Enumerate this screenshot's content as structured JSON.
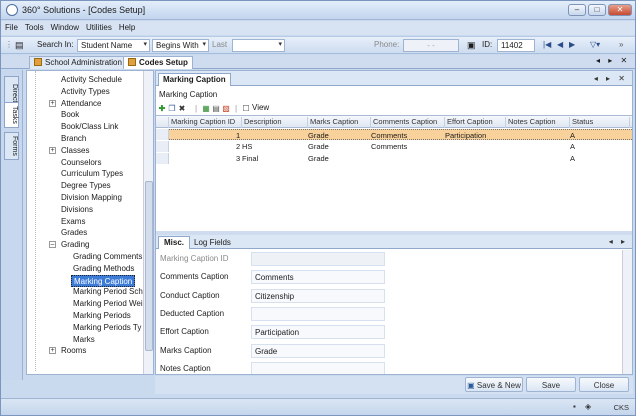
{
  "window": {
    "title": "360° Solutions - [Codes Setup]",
    "min": "–",
    "max": "□",
    "close": "✕"
  },
  "menu": [
    "File",
    "Tools",
    "Window",
    "Utilities",
    "Help"
  ],
  "toolbar": {
    "search_in_label": "Search In:",
    "search_in_value": "Student Name",
    "match_value": "Begins With",
    "field_label": "Last",
    "field_value": "",
    "phone_label": "Phone:",
    "phone_value": "-  -",
    "id_label": "ID:",
    "id_value": "11402"
  },
  "doc_tabs": [
    "School Administration",
    "Codes Setup"
  ],
  "side_tabs": [
    "Directories",
    "Tasks",
    "Forms"
  ],
  "tree": {
    "items": [
      {
        "label": "Activity Schedule",
        "level": 1,
        "expander": ""
      },
      {
        "label": "Activity Types",
        "level": 1,
        "expander": ""
      },
      {
        "label": "Attendance",
        "level": 1,
        "expander": "+"
      },
      {
        "label": "Book",
        "level": 1,
        "expander": ""
      },
      {
        "label": "Book/Class Link",
        "level": 1,
        "expander": ""
      },
      {
        "label": "Branch",
        "level": 1,
        "expander": ""
      },
      {
        "label": "Classes",
        "level": 1,
        "expander": "+"
      },
      {
        "label": "Counselors",
        "level": 1,
        "expander": ""
      },
      {
        "label": "Curriculum Types",
        "level": 1,
        "expander": ""
      },
      {
        "label": "Degree Types",
        "level": 1,
        "expander": ""
      },
      {
        "label": "Division Mapping",
        "level": 1,
        "expander": ""
      },
      {
        "label": "Divisions",
        "level": 1,
        "expander": ""
      },
      {
        "label": "Exams",
        "level": 1,
        "expander": ""
      },
      {
        "label": "Grades",
        "level": 1,
        "expander": ""
      },
      {
        "label": "Grading",
        "level": 1,
        "expander": "–"
      },
      {
        "label": "Grading Comments",
        "level": 2,
        "expander": ""
      },
      {
        "label": "Grading Methods",
        "level": 2,
        "expander": ""
      },
      {
        "label": "Marking Caption",
        "level": 2,
        "expander": "",
        "selected": true
      },
      {
        "label": "Marking Period Sch",
        "level": 2,
        "expander": ""
      },
      {
        "label": "Marking Period Wei",
        "level": 2,
        "expander": ""
      },
      {
        "label": "Marking Periods",
        "level": 2,
        "expander": ""
      },
      {
        "label": "Marking Periods Ty",
        "level": 2,
        "expander": ""
      },
      {
        "label": "Marks",
        "level": 2,
        "expander": ""
      },
      {
        "label": "Rooms",
        "level": 1,
        "expander": "+"
      }
    ]
  },
  "panel": {
    "tab": "Marking Caption",
    "nav": "◂ ▸ ✕",
    "title": "Marking Caption",
    "grid_toolbar": {
      "view_label": "View"
    },
    "columns": [
      "Marking Caption ID",
      "Description",
      "Marks Caption",
      "Comments Caption",
      "Effort Caption",
      "Notes Caption",
      "Status"
    ],
    "rows": [
      {
        "id": "1",
        "description": "",
        "marks": "Grade",
        "comments": "Comments",
        "effort": "Participation",
        "notes": "",
        "status": "A"
      },
      {
        "id": "2",
        "description": "HS",
        "marks": "Grade",
        "comments": "Comments",
        "effort": "",
        "notes": "",
        "status": "A"
      },
      {
        "id": "3",
        "description": "Final",
        "marks": "Grade",
        "comments": "",
        "effort": "",
        "notes": "",
        "status": "A"
      }
    ]
  },
  "detail": {
    "tabs": [
      "Misc.",
      "Log Fields"
    ],
    "fields": [
      {
        "label": "Marking Caption ID",
        "value": "",
        "disabled": true
      },
      {
        "label": "Comments Caption",
        "value": "Comments"
      },
      {
        "label": "Conduct Caption",
        "value": "Citizenship"
      },
      {
        "label": "Deducted Caption",
        "value": ""
      },
      {
        "label": "Effort Caption",
        "value": "Participation"
      },
      {
        "label": "Marks Caption",
        "value": "Grade"
      },
      {
        "label": "Notes Caption",
        "value": ""
      }
    ]
  },
  "buttons": {
    "save_new": "Save & New",
    "save": "Save",
    "close": "Close"
  },
  "status": {
    "text": "CKS"
  },
  "colors": {
    "selected_row": "#f9d19a",
    "selected_tree": "#3d7bd8",
    "accent": "#4a6da0"
  }
}
